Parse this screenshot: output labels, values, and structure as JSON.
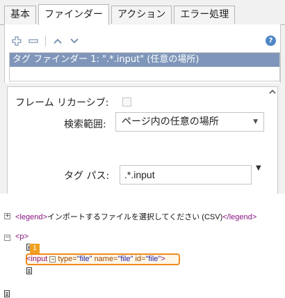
{
  "tabs": [
    "基本",
    "ファインダー",
    "アクション",
    "エラー処理"
  ],
  "active_tab": "ファインダー",
  "toolbar": {
    "add_icon": "plus-icon",
    "remove_icon": "minus-icon",
    "up_icon": "chevron-up-icon",
    "down_icon": "chevron-down-icon",
    "help_icon": "help-icon",
    "help_glyph": "?"
  },
  "finder_list": {
    "selected_item": "タグ ファインダー 1: \".*.input\" (任意の場所)"
  },
  "properties": {
    "frame_recursive_label": "フレーム リカーシブ:",
    "frame_recursive_checked": false,
    "search_scope_label": "検索範囲:",
    "search_scope_value": "ページ内の任意の場所",
    "tag_path_label": "タグ パス:",
    "tag_path_value": ".*.input"
  },
  "tree": {
    "legend_open": "<legend>",
    "legend_text": "インポートするファイルを選択してください (CSV)",
    "legend_close": "</legend>",
    "p_tag": "<p>",
    "badge": "1",
    "input_tag": "<input",
    "attr_type_name": "type=",
    "attr_type_value": "\"file\"",
    "attr_name_name": "name=",
    "attr_name_value": "\"file\"",
    "attr_id_name": "id=",
    "attr_id_value": "\"file\"",
    "input_close": ">"
  },
  "colors": {
    "selection_bg": "#7f96ba",
    "highlight_border": "#f08a1c",
    "badge_bg": "#f0a020",
    "tag_color": "#881280"
  }
}
